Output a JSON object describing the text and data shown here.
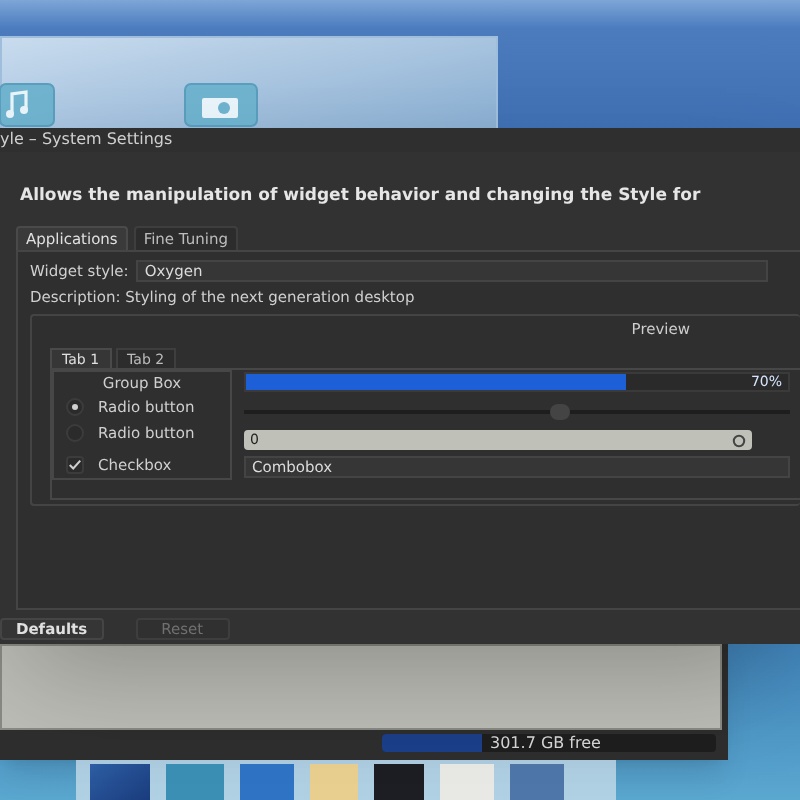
{
  "background_window": {
    "status_bar": {
      "free_space": "301.7 GB free",
      "level": 0.3
    }
  },
  "window": {
    "title": "yle – System Settings",
    "header": "Allows the manipulation of widget behavior and changing the Style for",
    "tabs": [
      {
        "label": "Applications",
        "selected": true
      },
      {
        "label": "Fine Tuning",
        "selected": false
      }
    ],
    "widget_style": {
      "label": "Widget style:",
      "value": "Oxygen"
    },
    "description": "Description: Styling of the next generation desktop",
    "preview": {
      "title": "Preview",
      "tabs": [
        {
          "label": "Tab 1",
          "selected": true
        },
        {
          "label": "Tab 2",
          "selected": false
        }
      ],
      "group_box": {
        "title": "Group Box",
        "items": [
          {
            "kind": "radio",
            "label": "Radio button",
            "checked": true
          },
          {
            "kind": "radio",
            "label": "Radio button",
            "checked": false
          },
          {
            "kind": "checkbox",
            "label": "Checkbox",
            "checked": true
          }
        ]
      },
      "progress": {
        "level": 0.7,
        "text": "70%"
      },
      "slider": {
        "level": 0.58
      },
      "spinbox": {
        "value": "0"
      },
      "combobox": {
        "value": "Combobox"
      }
    },
    "buttons": [
      {
        "label": "Defaults",
        "disabled": false
      },
      {
        "label": "Reset",
        "disabled": true
      }
    ]
  }
}
